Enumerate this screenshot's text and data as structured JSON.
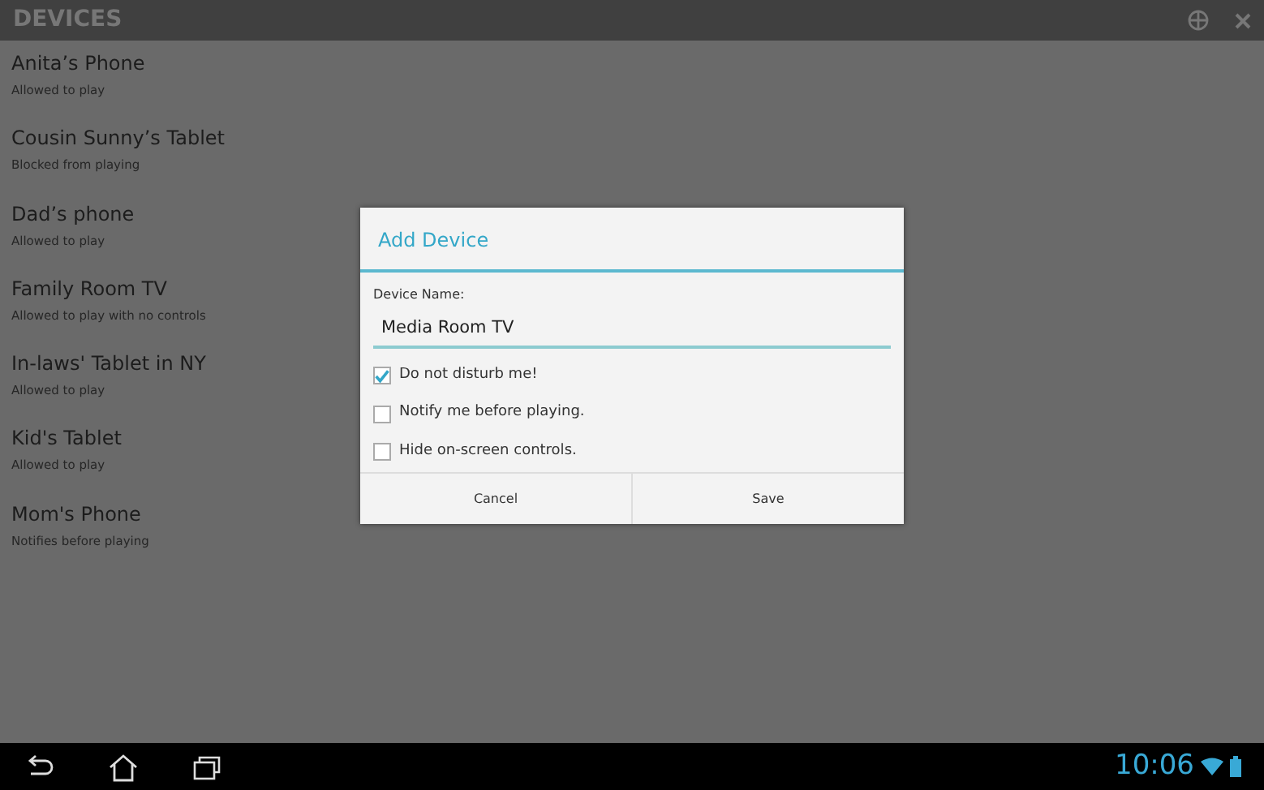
{
  "action_bar": {
    "title": "DEVICES"
  },
  "devices": [
    {
      "name": "Anita’s Phone",
      "status": "Allowed to play"
    },
    {
      "name": "Cousin Sunny’s Tablet",
      "status": "Blocked from playing"
    },
    {
      "name": "Dad’s phone",
      "status": "Allowed to play"
    },
    {
      "name": "Family Room TV",
      "status": "Allowed to play with no controls"
    },
    {
      "name": "In-laws' Tablet in NY",
      "status": "Allowed to play"
    },
    {
      "name": "Kid's Tablet",
      "status": "Allowed to play"
    },
    {
      "name": "Mom's Phone",
      "status": "Notifies before playing"
    }
  ],
  "dialog": {
    "title": "Add Device",
    "field_label": "Device Name:",
    "field_value": "Media Room TV",
    "options": [
      {
        "label": "Do not disturb me!",
        "checked": true
      },
      {
        "label": "Notify me before playing.",
        "checked": false
      },
      {
        "label": "Hide on-screen controls.",
        "checked": false
      }
    ],
    "buttons": [
      "Cancel",
      "Save"
    ]
  },
  "status_bar": {
    "time": "10:06"
  }
}
